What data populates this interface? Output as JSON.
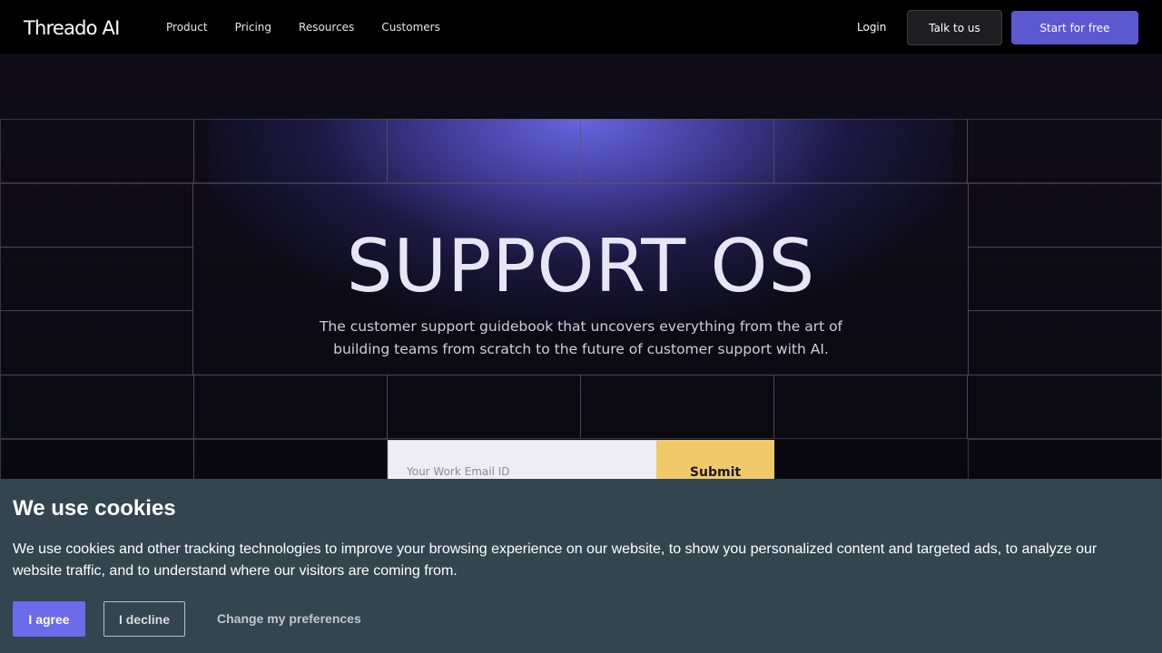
{
  "nav": {
    "logo": "Threado AI",
    "links": [
      "Product",
      "Pricing",
      "Resources",
      "Customers"
    ],
    "login": "Login",
    "talk": "Talk to us",
    "start": "Start for free"
  },
  "hero": {
    "title": "SUPPORT OS",
    "subtitle": "The customer support guidebook that uncovers everything from the art of building teams from scratch to the future of customer support with AI.",
    "email_placeholder": "Your Work Email ID",
    "submit": "Submit"
  },
  "cookie": {
    "title": "We use cookies",
    "text": "We use cookies and other tracking technologies to improve your browsing experience on our website, to show you personalized content and targeted ads, to analyze our website traffic, and to understand where our visitors are coming from.",
    "agree": "I agree",
    "decline": "I decline",
    "preferences": "Change my preferences"
  },
  "colors": {
    "accent": "#5c58d0",
    "submit": "#f0c96a",
    "cookie_bg": "#33454f",
    "agree": "#6b6ae8"
  }
}
